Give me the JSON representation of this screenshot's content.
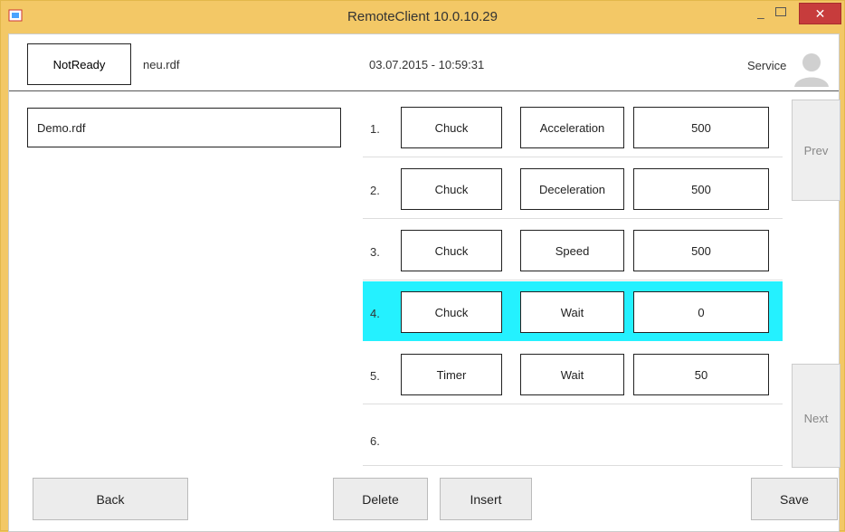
{
  "window": {
    "title": "RemoteClient 10.0.10.29"
  },
  "header": {
    "status": "NotReady",
    "file": "neu.rdf",
    "datetime": "03.07.2015 - 10:59:31",
    "role": "Service"
  },
  "left": {
    "file": "Demo.rdf"
  },
  "rows": [
    {
      "num": "1.",
      "device": "Chuck",
      "param": "Acceleration",
      "value": "500"
    },
    {
      "num": "2.",
      "device": "Chuck",
      "param": "Deceleration",
      "value": "500"
    },
    {
      "num": "3.",
      "device": "Chuck",
      "param": "Speed",
      "value": "500"
    },
    {
      "num": "4.",
      "device": "Chuck",
      "param": "Wait",
      "value": "0"
    },
    {
      "num": "5.",
      "device": "Timer",
      "param": "Wait",
      "value": "50"
    },
    {
      "num": "6."
    }
  ],
  "side": {
    "prev": "Prev",
    "next": "Next"
  },
  "buttons": {
    "back": "Back",
    "delete": "Delete",
    "insert": "Insert",
    "save": "Save"
  },
  "colors": {
    "highlight": "#24f1ff",
    "titlebar": "#f3c866",
    "close": "#c73c3c"
  }
}
